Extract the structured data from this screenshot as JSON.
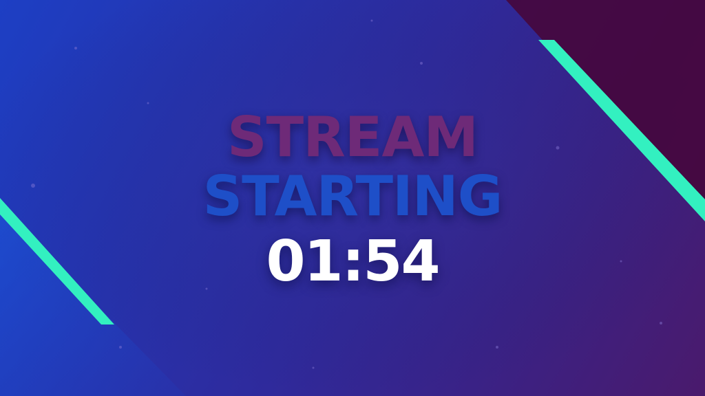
{
  "screen": {
    "title_top": "STREAM",
    "title_bottom": "STARTING",
    "countdown": "01:54"
  },
  "colors": {
    "accent_stripe": "#33f0c0",
    "title_top": "#6e2a78",
    "title_bottom": "#1e4fc8",
    "countdown": "#ffffff",
    "bg_left": "#1d3fc4",
    "bg_right": "#4a1a6c",
    "corner_panel": "#45083e"
  }
}
